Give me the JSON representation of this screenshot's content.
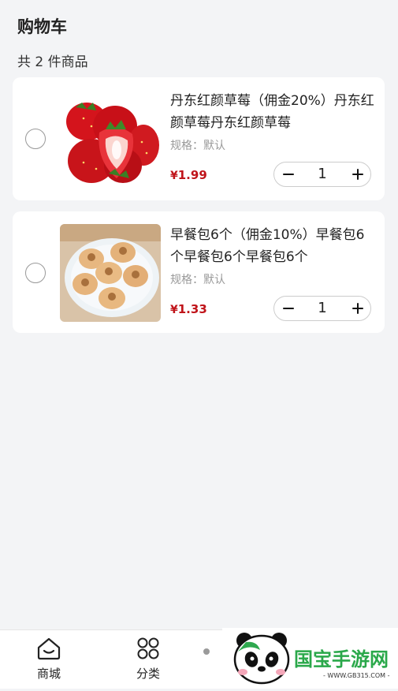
{
  "header": {
    "title": "购物车",
    "count_text": "共 2 件商品"
  },
  "cart": {
    "items": [
      {
        "name": "丹东红颜草莓（佣金20%）丹东红颜草莓丹东红颜草莓",
        "spec": "规格：默认",
        "currency": "¥",
        "price": "1.99",
        "quantity": "1",
        "image": "strawberry",
        "selected": false
      },
      {
        "name": "早餐包6个（佣金10%）早餐包6个早餐包6个早餐包6个",
        "spec": "规格：默认",
        "currency": "¥",
        "price": "1.33",
        "quantity": "1",
        "image": "breakfast-buns",
        "selected": false
      }
    ]
  },
  "tabbar": {
    "tabs": [
      {
        "label": "商城",
        "icon": "home-icon"
      },
      {
        "label": "分类",
        "icon": "category-icon"
      }
    ]
  },
  "watermark": {
    "brand": "国宝手游网",
    "url": "- WWW.GB315.COM -"
  },
  "colors": {
    "price": "#c0141a",
    "background": "#f3f4f6",
    "card": "#ffffff"
  }
}
